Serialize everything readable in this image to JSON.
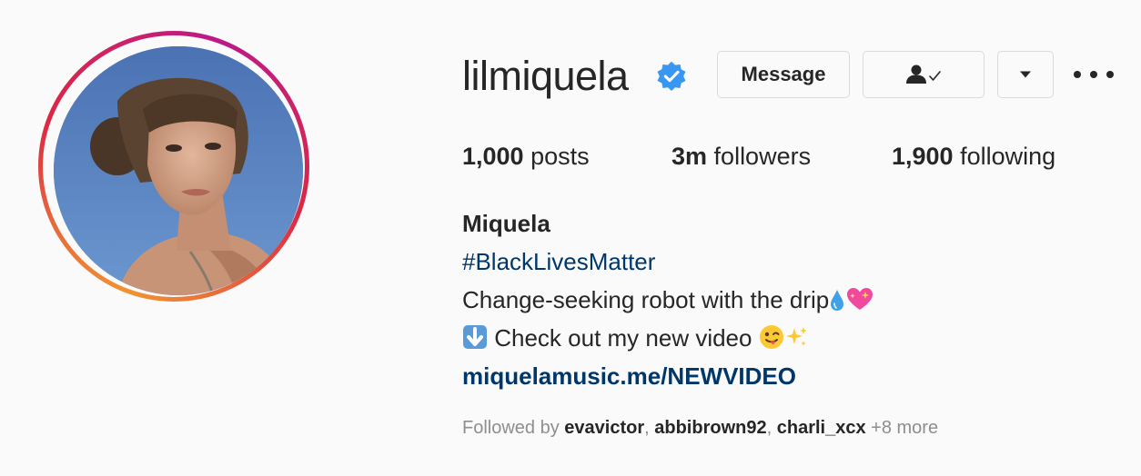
{
  "profile": {
    "username": "lilmiquela",
    "verified": true,
    "buttons": {
      "message_label": "Message"
    },
    "stats": {
      "posts_count": "1,000",
      "posts_label": "posts",
      "followers_count": "3m",
      "followers_label": "followers",
      "following_count": "1,900",
      "following_label": "following"
    },
    "bio": {
      "name": "Miquela",
      "hashtag": "#BlackLivesMatter",
      "line1": "Change-seeking robot with the drip",
      "line2": "Check out my new video",
      "link": "miquelamusic.me/NEWVIDEO"
    },
    "followed_by": {
      "prefix": "Followed by",
      "names": [
        "evavictor",
        "abbibrown92",
        "charli_xcx"
      ],
      "more": "+8 more"
    }
  },
  "icons": {
    "verified": "verified-badge-icon",
    "following": "person-check-icon",
    "dropdown": "caret-down-icon",
    "more": "more-horizontal-icon"
  },
  "colors": {
    "verified_blue": "#3897f0",
    "link_blue": "#00376b",
    "muted_text": "#8e8e8e",
    "border": "#dbdbdb"
  }
}
